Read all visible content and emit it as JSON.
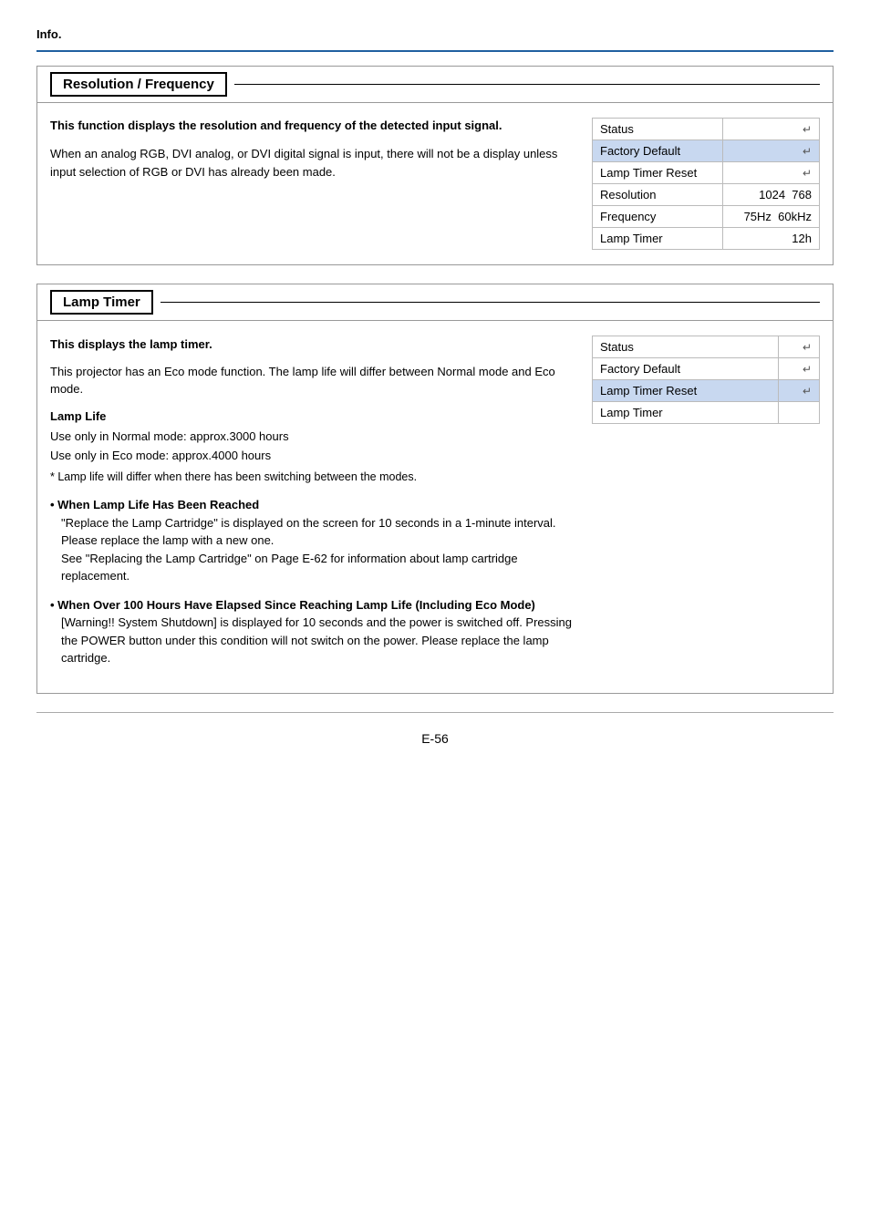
{
  "header": {
    "label": "Info."
  },
  "resolution_section": {
    "title": "Resolution / Frequency",
    "intro_bold": "This function displays the resolution and frequency of the detected input signal.",
    "body_text": "When an analog RGB, DVI analog, or DVI digital signal is input, there will not be a display unless input selection of RGB or DVI has already been made.",
    "table": {
      "rows": [
        {
          "label": "Status",
          "value": "",
          "has_enter": true,
          "highlighted": false
        },
        {
          "label": "Factory Default",
          "value": "",
          "has_enter": true,
          "highlighted": true
        },
        {
          "label": "Lamp Timer Reset",
          "value": "",
          "has_enter": true,
          "highlighted": false
        },
        {
          "label": "Resolution",
          "value1": "1024",
          "value2": "768",
          "has_enter": false,
          "highlighted": false
        },
        {
          "label": "Frequency",
          "value1": "75Hz",
          "value2": "60kHz",
          "has_enter": false,
          "highlighted": false
        },
        {
          "label": "Lamp Timer",
          "value1": "",
          "value2": "12h",
          "has_enter": false,
          "highlighted": false
        }
      ]
    }
  },
  "lamp_timer_section": {
    "title": "Lamp Timer",
    "intro_bold": "This displays the lamp timer.",
    "body_text": "This projector has an Eco mode function. The lamp life will differ between Normal mode and Eco mode.",
    "lamp_life_title": "Lamp Life",
    "lamp_life_lines": [
      "Use only in Normal mode: approx.3000 hours",
      "Use only in Eco mode: approx.4000 hours"
    ],
    "asterisk_note": "*  Lamp life will differ when there has been switching between the modes.",
    "bullets": [
      {
        "title": "When Lamp Life Has Been Reached",
        "text": "\"Replace the Lamp Cartridge\" is displayed on the screen for 10 seconds in a 1-minute interval.\nPlease replace the lamp with a new one.\nSee \"Replacing the Lamp Cartridge\" on Page E-62 for information about lamp cartridge replacement."
      },
      {
        "title": "When Over 100 Hours Have Elapsed Since Reaching Lamp Life (Including Eco Mode)",
        "text": "[Warning!! System Shutdown] is displayed for 10 seconds and the power is switched off. Pressing the POWER button under this condition will not switch on the power. Please replace the lamp cartridge."
      }
    ],
    "table": {
      "rows": [
        {
          "label": "Status",
          "value": "",
          "has_enter": true,
          "highlighted": false
        },
        {
          "label": "Factory Default",
          "value": "",
          "has_enter": true,
          "highlighted": false
        },
        {
          "label": "Lamp Timer Reset",
          "value": "",
          "has_enter": true,
          "highlighted": true
        },
        {
          "label": "Lamp Timer",
          "value": "",
          "has_enter": false,
          "highlighted": false
        }
      ]
    }
  },
  "footer": {
    "page_label": "E-56"
  },
  "icons": {
    "enter": "↵"
  }
}
